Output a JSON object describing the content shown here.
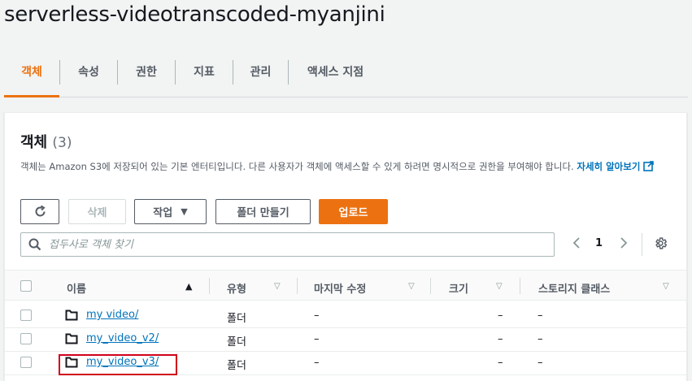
{
  "bucket": {
    "title": "serverless-videotranscoded-myanjini"
  },
  "tabs": [
    {
      "label": "객체",
      "active": true
    },
    {
      "label": "속성",
      "active": false
    },
    {
      "label": "권한",
      "active": false
    },
    {
      "label": "지표",
      "active": false
    },
    {
      "label": "관리",
      "active": false
    },
    {
      "label": "액세스 지점",
      "active": false
    }
  ],
  "objects_panel": {
    "title": "객체",
    "count": "(3)",
    "description": "객체는 Amazon S3에 저장되어 있는 기본 엔터티입니다. 다른 사용자가 객체에 액세스할 수 있게 하려면 명시적으로 권한을 부여해야 합니다.",
    "learn_more": "자세히 알아보기"
  },
  "toolbar": {
    "delete_label": "삭제",
    "actions_label": "작업",
    "create_folder_label": "폴더 만들기",
    "upload_label": "업로드"
  },
  "search": {
    "placeholder": "접두사로 객체 찾기"
  },
  "pagination": {
    "current_page": "1"
  },
  "table": {
    "columns": [
      "이름",
      "유형",
      "마지막 수정",
      "크기",
      "스토리지 클래스"
    ],
    "rows": [
      {
        "name": "my video/",
        "type": "폴더",
        "last_modified": "–",
        "size": "–",
        "storage_class": "–"
      },
      {
        "name": "my_video_v2/",
        "type": "폴더",
        "last_modified": "–",
        "size": "–",
        "storage_class": "–"
      },
      {
        "name": "my_video_v3/",
        "type": "폴더",
        "last_modified": "–",
        "size": "–",
        "storage_class": "–"
      }
    ]
  },
  "colors": {
    "accent": "#ec7211",
    "link": "#0073bb",
    "highlight": "#d0021b"
  },
  "icons": [
    "refresh-icon",
    "caret-down-icon",
    "search-icon",
    "chevron-left-icon",
    "chevron-right-icon",
    "gear-icon",
    "folder-icon",
    "external-link-icon",
    "sort-ascending-icon",
    "sort-descending-icon"
  ]
}
